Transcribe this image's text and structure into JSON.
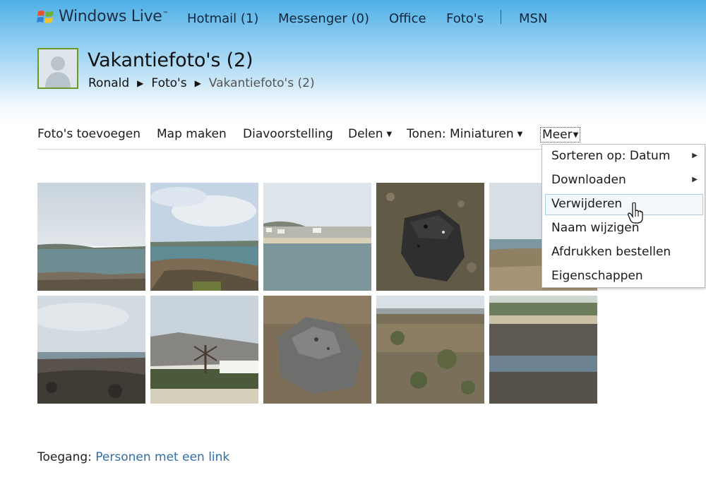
{
  "brand": {
    "name": "Windows Live",
    "tm": "™"
  },
  "nav": {
    "hotmail": "Hotmail (1)",
    "messenger": "Messenger (0)",
    "office": "Office",
    "photos": "Foto's",
    "msn": "MSN"
  },
  "header": {
    "title": "Vakantiefoto's (2)",
    "breadcrumb": [
      "Ronald",
      "Foto's",
      "Vakantiefoto's (2)"
    ]
  },
  "toolbar": {
    "add_photos": "Foto's toevoegen",
    "make_folder": "Map maken",
    "slideshow": "Diavoorstelling",
    "share": "Delen",
    "view": "Tonen: Miniaturen",
    "more": "Meer"
  },
  "menu": {
    "items": [
      {
        "label": "Sorteren op: Datum",
        "submenu": true
      },
      {
        "label": "Downloaden",
        "submenu": true
      },
      {
        "label": "Verwijderen",
        "submenu": false
      },
      {
        "label": "Naam wijzigen",
        "submenu": false
      },
      {
        "label": "Afdrukken bestellen",
        "submenu": false
      },
      {
        "label": "Eigenschappen",
        "submenu": false
      }
    ],
    "hovered": "Verwijderen"
  },
  "photos": {
    "count": 10
  },
  "access": {
    "label": "Toegang:",
    "value": "Personen met een link"
  },
  "colors": {
    "link": "#2f6ea8",
    "avatar_border": "#6a9b2a",
    "header_sky": "#4fb0e6",
    "menu_hover": "#a9cbe3"
  },
  "icons": [
    "windows-flag-icon",
    "user-avatar-icon",
    "caret-down-icon",
    "submenu-arrow-icon",
    "hand-cursor-icon"
  ]
}
